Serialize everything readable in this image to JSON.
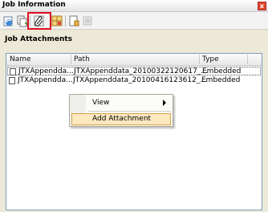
{
  "window": {
    "title": "Job Information",
    "close_label": "x"
  },
  "toolbar": {
    "buttons": [
      "sync-icon",
      "copy-icon",
      "attach-icon",
      "grid-icon",
      "page-icon",
      "disabled-icon"
    ]
  },
  "section": {
    "title": "Job Attachments"
  },
  "table": {
    "columns": [
      "Name",
      "Path",
      "Type"
    ],
    "rows": [
      {
        "name": "JTXAppendda...",
        "path": "JTXAppenddata_20100322120617_...",
        "type": "Embedded"
      },
      {
        "name": "JTXAppendda...",
        "path": "JTXAppenddata_20100416123612_...",
        "type": "Embedded"
      }
    ]
  },
  "context_menu": {
    "items": [
      {
        "label": "View"
      },
      {
        "label": "Add Attachment"
      }
    ]
  },
  "colors": {
    "highlight_border": "#e01020",
    "menu_hover": "#fde8c0"
  }
}
